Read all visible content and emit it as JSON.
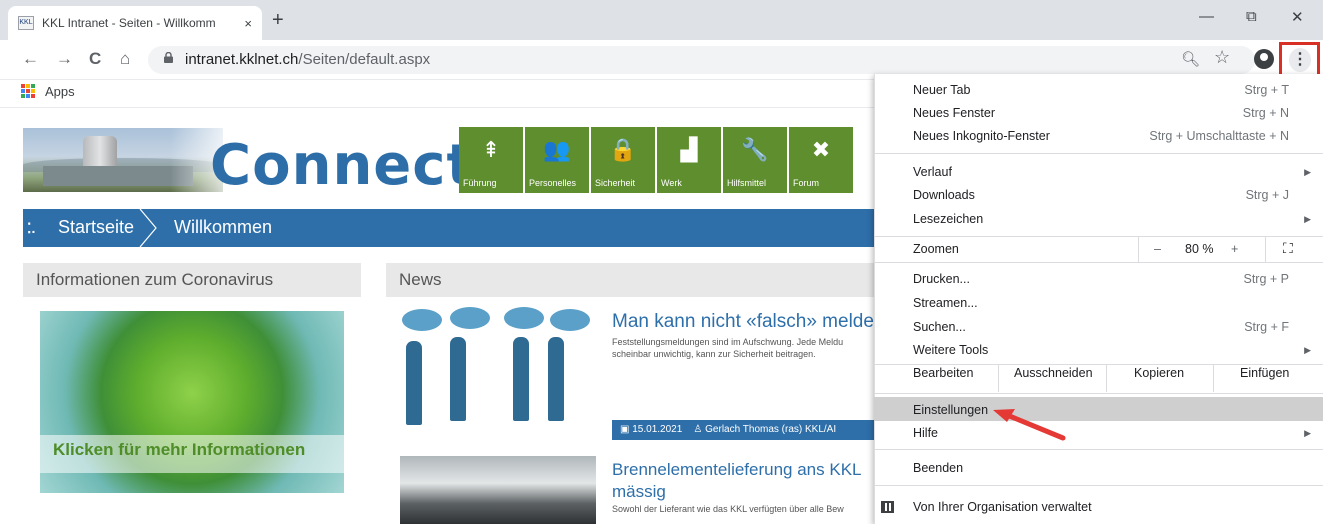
{
  "browser": {
    "tab_title": "KKL Intranet - Seiten - Willkomm",
    "tab_close": "×",
    "new_tab": "+",
    "favicon": "KKL",
    "url_host": "intranet.kklnet.ch",
    "url_path": "/Seiten/default.aspx",
    "window": {
      "minimize": "—",
      "restore": "⧉",
      "close": "✕"
    },
    "nav": {
      "back": "←",
      "forward": "→",
      "reload": "C",
      "home": "⌂"
    },
    "bookmarks": {
      "apps": "Apps"
    },
    "icons": [
      "lock-icon",
      "zoom-icon",
      "star-icon",
      "profile-icon",
      "kebab-menu-icon",
      "apps-grid-icon"
    ]
  },
  "page": {
    "brand": "Connect",
    "tiles": [
      {
        "label": "Führung",
        "icon": "signpost-icon",
        "glyph": "⇞"
      },
      {
        "label": "Personelles",
        "icon": "people-icon",
        "glyph": "👥"
      },
      {
        "label": "Sicherheit",
        "icon": "lock-icon",
        "glyph": "🔒"
      },
      {
        "label": "Werk",
        "icon": "factory-icon",
        "glyph": "▟"
      },
      {
        "label": "Hilfsmittel",
        "icon": "wrench-icon",
        "glyph": "🔧"
      },
      {
        "label": "Forum",
        "icon": "forum-icon",
        "glyph": "✖"
      }
    ],
    "breadcrumb": {
      "home": "Startseite",
      "current": "Willkommen",
      "icon": "⁚."
    },
    "corona": {
      "header": "Informationen zum Coronavirus",
      "banner": "Klicken für mehr Informationen"
    },
    "news": {
      "header": "News",
      "items": [
        {
          "title": "Man kann nicht «falsch» melden",
          "text": "Feststellungsmeldungen sind im Aufschwung. Jede Meldu scheinbar unwichtig, kann zur Sicherheit beitragen.",
          "date": "15.01.2021",
          "author": "Gerlach Thomas (ras) KKL/AI"
        },
        {
          "title_line1": "Brennelementelieferung ans KKL",
          "title_line2": "mässig",
          "text": "Sowohl der Lieferant wie das KKL verfügten über alle Bew"
        }
      ]
    }
  },
  "menu": {
    "new_tab": {
      "label": "Neuer Tab",
      "shortcut": "Strg + T"
    },
    "new_window": {
      "label": "Neues Fenster",
      "shortcut": "Strg + N"
    },
    "incognito": {
      "label": "Neues Inkognito-Fenster",
      "shortcut": "Strg + Umschalttaste + N"
    },
    "history": {
      "label": "Verlauf"
    },
    "downloads": {
      "label": "Downloads",
      "shortcut": "Strg + J"
    },
    "bookmarks": {
      "label": "Lesezeichen"
    },
    "zoom": {
      "label": "Zoomen",
      "minus": "–",
      "value": "80 %",
      "plus": "+",
      "fullscreen": "⛶"
    },
    "print": {
      "label": "Drucken...",
      "shortcut": "Strg + P"
    },
    "cast": {
      "label": "Streamen..."
    },
    "find": {
      "label": "Suchen...",
      "shortcut": "Strg + F"
    },
    "more_tools": {
      "label": "Weitere Tools"
    },
    "edit": {
      "label": "Bearbeiten",
      "cut": "Ausschneiden",
      "copy": "Kopieren",
      "paste": "Einfügen"
    },
    "settings": {
      "label": "Einstellungen"
    },
    "help": {
      "label": "Hilfe"
    },
    "exit": {
      "label": "Beenden"
    },
    "managed": {
      "label": "Von Ihrer Organisation verwaltet"
    }
  },
  "colors": {
    "brand_blue": "#2e6faa",
    "tile_green": "#5f8e2e",
    "highlight": "#d93025",
    "menu_highlight": "#cfcfcf"
  }
}
